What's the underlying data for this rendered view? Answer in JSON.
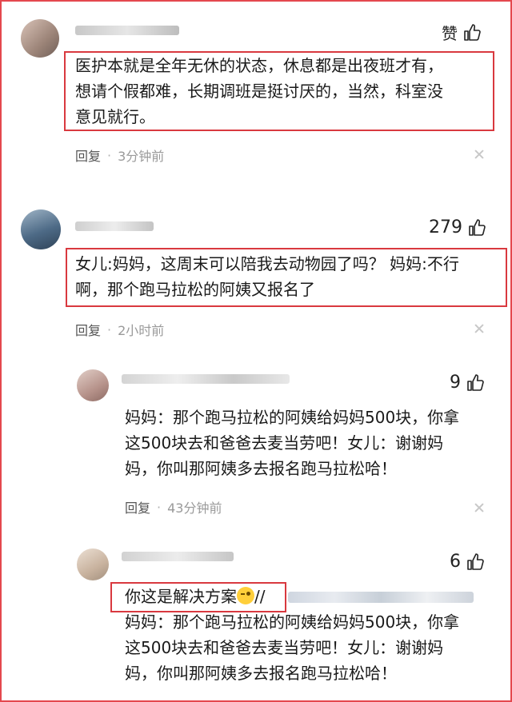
{
  "comments": [
    {
      "like": "赞",
      "text": [
        "医护本就是全年无休的状态，休息都是出夜班才有，",
        "想请个假都难，长期调班是挺讨厌的，当然，科室没",
        "意见就行。"
      ],
      "reply": "回复",
      "dot": "·",
      "time": "3分钟前"
    },
    {
      "like": "279",
      "text": [
        "女儿:妈妈，这周末可以陪我去动物园了吗？ 妈妈:不行",
        "啊，那个跑马拉松的阿姨又报名了"
      ],
      "reply": "回复",
      "dot": "·",
      "time": "2小时前"
    },
    {
      "like": "9",
      "text": [
        "妈妈：那个跑马拉松的阿姨给妈妈500块，你拿",
        "这500块去和爸爸去麦当劳吧！女儿：谢谢妈",
        "妈，你叫那阿姨多去报名跑马拉松哈！"
      ],
      "reply": "回复",
      "dot": "·",
      "time": "43分钟前"
    },
    {
      "like": "6",
      "first_line": "你这是解决方案",
      "after_emoji": "//",
      "text": [
        "妈妈：那个跑马拉松的阿姨给妈妈500块，你拿",
        "这500块去和爸爸去麦当劳吧！女儿：谢谢妈",
        "妈，你叫那阿姨多去报名跑马拉松哈！"
      ]
    }
  ],
  "icons": {
    "like": "thumbs-up-icon",
    "close": "close-icon",
    "emoji": "wink-emoji-icon"
  },
  "colors": {
    "highlight_border": "#d9393f",
    "frame_border": "#e4484e"
  }
}
